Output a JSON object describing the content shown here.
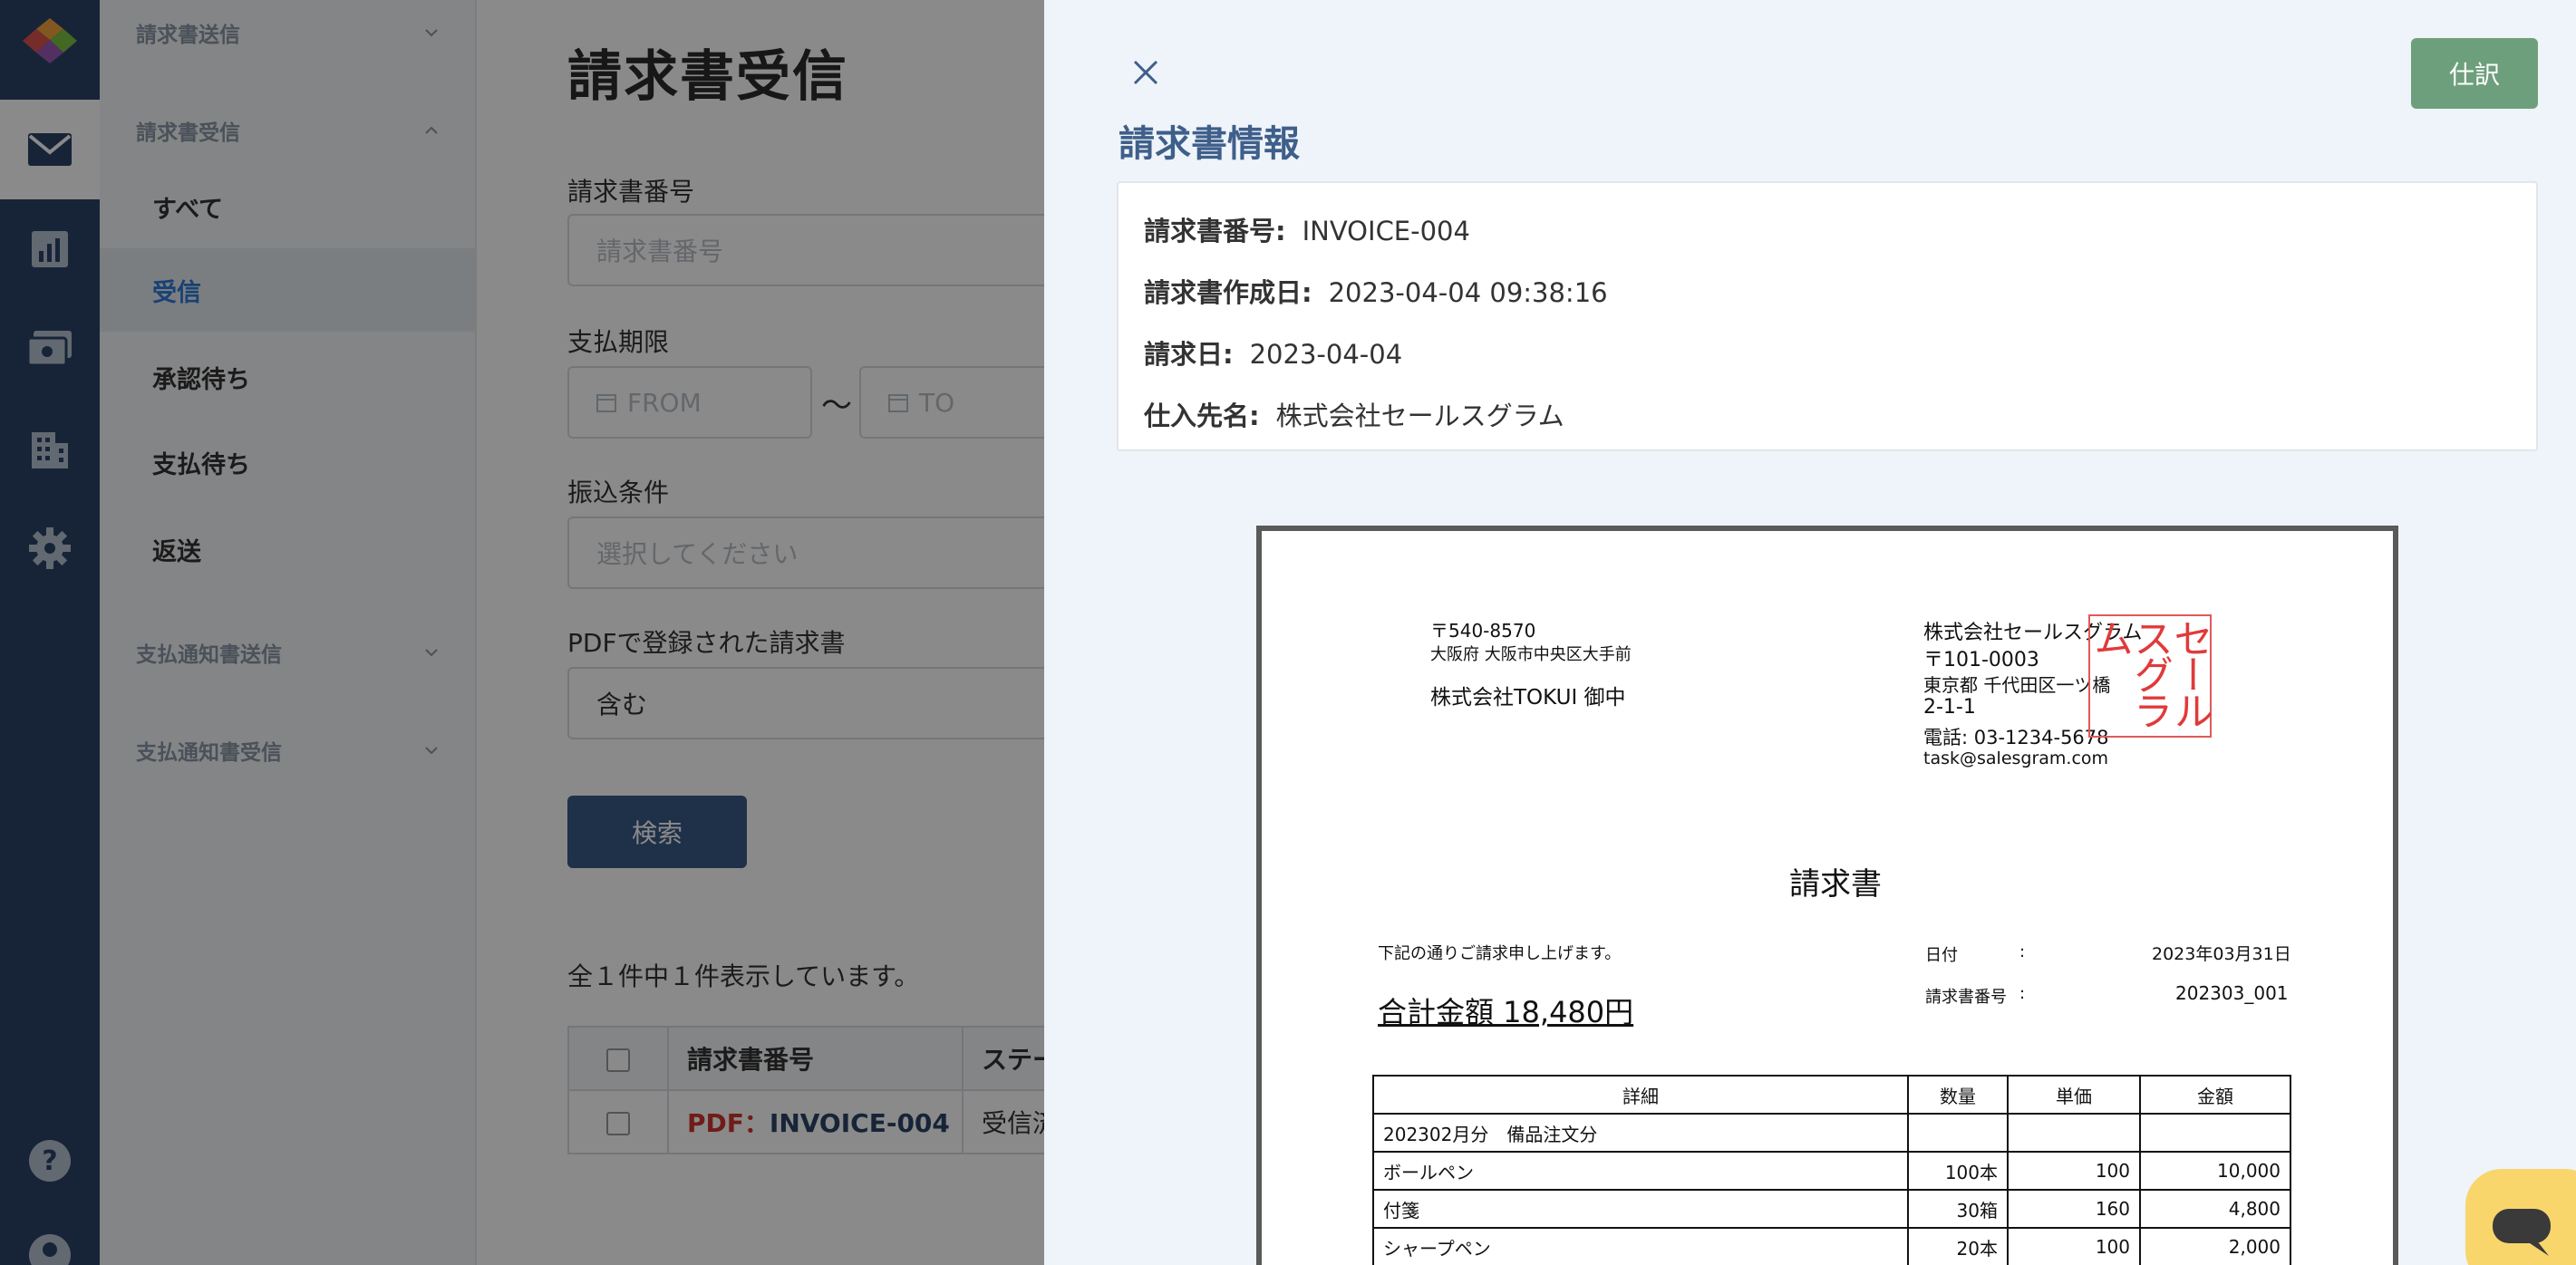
{
  "rail": {
    "icons": [
      "logo-icon",
      "mail-icon",
      "chart-icon",
      "money-icon",
      "building-icon",
      "gear-icon",
      "help-icon",
      "user-icon"
    ]
  },
  "sidebar": {
    "group_send": "請求書送信",
    "group_receive": "請求書受信",
    "items": [
      {
        "label": "すべて"
      },
      {
        "label": "受信"
      },
      {
        "label": "承認待ち"
      },
      {
        "label": "支払待ち"
      },
      {
        "label": "返送"
      }
    ],
    "group_payment_send": "支払通知書送信",
    "group_payment_receive": "支払通知書受信"
  },
  "main": {
    "title": "請求書受信",
    "invoice_number_label": "請求書番号",
    "invoice_number_placeholder": "請求書番号",
    "due_label": "支払期限",
    "from_placeholder": "FROM",
    "tilde": "〜",
    "to_placeholder": "TO",
    "transfer_label": "振込条件",
    "transfer_placeholder": "選択してください",
    "pdf_label": "PDFで登録された請求書",
    "pdf_value": "含む",
    "search_button": "検索",
    "count_text": "全１件中１件表示しています。",
    "table": {
      "col_number": "請求書番号",
      "col_status": "ステー",
      "rows": [
        {
          "pdf": "PDF：",
          "number": "INVOICE-004",
          "status": "受信済"
        }
      ]
    }
  },
  "drawer": {
    "shiwake_button": "仕訳",
    "title": "請求書情報",
    "info": [
      {
        "key": "請求書番号:",
        "value": "INVOICE-004"
      },
      {
        "key": "請求書作成日:",
        "value": "2023-04-04 09:38:16"
      },
      {
        "key": "請求日:",
        "value": "2023-04-04"
      },
      {
        "key": "仕入先名:",
        "value": "株式会社セールスグラム"
      }
    ]
  },
  "invoice": {
    "to_zip": "〒540-8570",
    "to_address": "大阪府 大阪市中央区大手前",
    "to_name": "株式会社TOKUI 御中",
    "from_name": "株式会社セールスグラム",
    "from_zip": "〒101-0003",
    "from_address1": "東京都 千代田区一ツ橋",
    "from_address2": "2-1-1",
    "from_phone": "電話: 03-1234-5678",
    "from_email": "task@salesgram.com",
    "stamp_col1": "セール",
    "stamp_col2": "スグラ",
    "stamp_col3": "ム",
    "doc_title": "請求書",
    "greeting": "下記の通りご請求申し上げます。",
    "total_label": "合計金額 18,480円",
    "date_label": "日付",
    "colon": ":",
    "date_value": "2023年03月31日",
    "number_label": "請求書番号",
    "number_value": "202303_001",
    "table": {
      "headers": [
        "詳細",
        "数量",
        "単価",
        "金額"
      ],
      "rows": [
        [
          "202302月分　備品注文分",
          "",
          "",
          ""
        ],
        [
          "ボールペン",
          "100本",
          "100",
          "10,000"
        ],
        [
          "付箋",
          "30箱",
          "160",
          "4,800"
        ],
        [
          "シャープペン",
          "20本",
          "100",
          "2,000"
        ]
      ]
    }
  },
  "colors": {
    "rail": "#2c4468",
    "accent": "#2e7bd6",
    "drawer_title": "#3f5f8a",
    "shiwake": "#6e9f7c",
    "pdf_red": "#d0342c",
    "stamp_red": "#e03a3a"
  }
}
